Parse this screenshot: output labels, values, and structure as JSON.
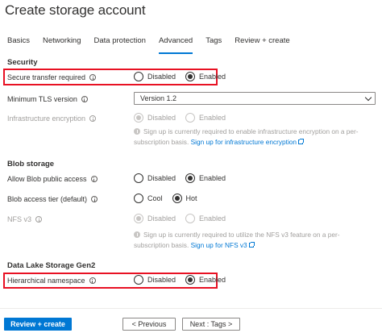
{
  "page": {
    "title": "Create storage account"
  },
  "tabs": [
    {
      "label": "Basics"
    },
    {
      "label": "Networking"
    },
    {
      "label": "Data protection"
    },
    {
      "label": "Advanced"
    },
    {
      "label": "Tags"
    },
    {
      "label": "Review + create"
    }
  ],
  "active_tab": "Advanced",
  "security": {
    "heading": "Security",
    "secure_transfer": {
      "label": "Secure transfer required",
      "options": [
        "Disabled",
        "Enabled"
      ],
      "selected": "Enabled"
    },
    "tls": {
      "label": "Minimum TLS version",
      "value": "Version 1.2"
    },
    "infra_encryption": {
      "label": "Infrastructure encryption",
      "options": [
        "Disabled",
        "Enabled"
      ],
      "selected": "Disabled",
      "notice_text": "Sign up is currently required to enable infrastructure encryption on a per-subscription basis.",
      "notice_link": "Sign up for infrastructure encryption"
    }
  },
  "blob": {
    "heading": "Blob storage",
    "public_access": {
      "label": "Allow Blob public access",
      "options": [
        "Disabled",
        "Enabled"
      ],
      "selected": "Enabled"
    },
    "access_tier": {
      "label": "Blob access tier (default)",
      "options": [
        "Cool",
        "Hot"
      ],
      "selected": "Hot"
    },
    "nfs": {
      "label": "NFS v3",
      "options": [
        "Disabled",
        "Enabled"
      ],
      "selected": "Disabled",
      "notice_text": "Sign up is currently required to utilize the NFS v3 feature on a per-subscription basis.",
      "notice_link": "Sign up for NFS v3"
    }
  },
  "datalake": {
    "heading": "Data Lake Storage Gen2",
    "hns": {
      "label": "Hierarchical namespace",
      "options": [
        "Disabled",
        "Enabled"
      ],
      "selected": "Enabled"
    }
  },
  "footer": {
    "review_create": "Review + create",
    "previous": "< Previous",
    "next": "Next : Tags >"
  },
  "colors": {
    "accent": "#0078d4",
    "highlight": "#e81123"
  }
}
